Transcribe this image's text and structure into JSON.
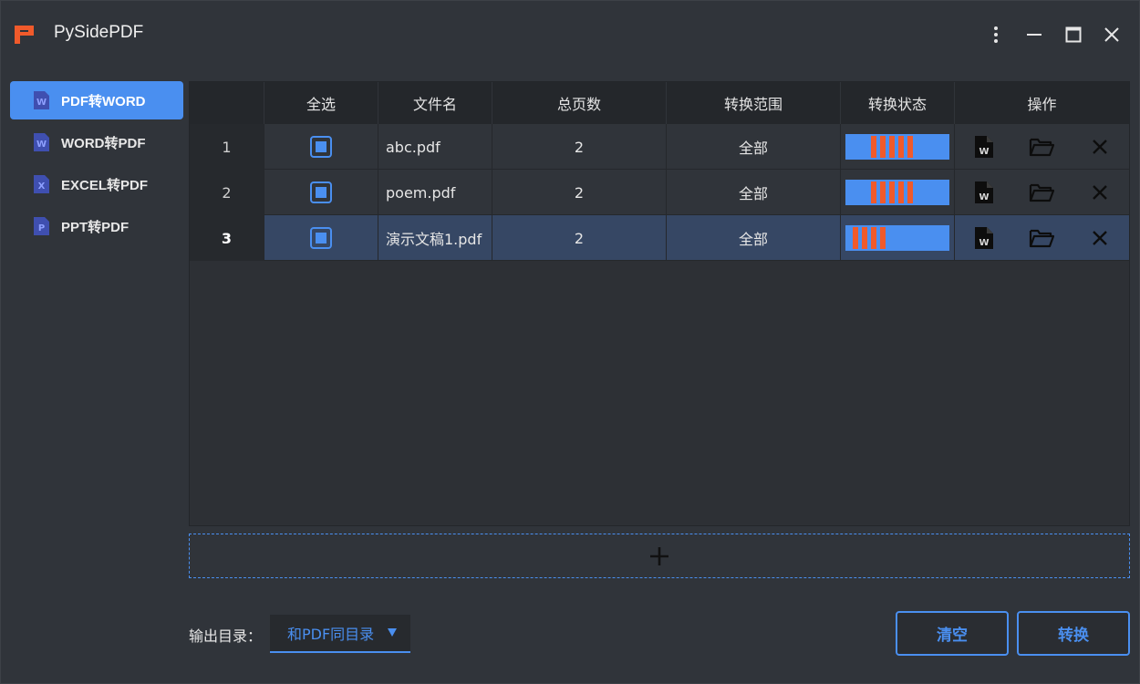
{
  "app": {
    "title": "PySidePDF"
  },
  "colors": {
    "accent": "#4a8ff0",
    "progress_fill": "#f05a2b",
    "background": "#30343a"
  },
  "sidebar": {
    "items": [
      {
        "label": "PDF转WORD",
        "icon": "word-doc-icon",
        "active": true
      },
      {
        "label": "WORD转PDF",
        "icon": "word-doc-icon",
        "active": false
      },
      {
        "label": "EXCEL转PDF",
        "icon": "excel-doc-icon",
        "active": false
      },
      {
        "label": "PPT转PDF",
        "icon": "ppt-doc-icon",
        "active": false
      }
    ]
  },
  "table": {
    "headers": [
      "",
      "全选",
      "文件名",
      "总页数",
      "转换范围",
      "转换状态",
      "操作"
    ],
    "rows": [
      {
        "num": "1",
        "checked": true,
        "filename": "abc.pdf",
        "pages": "2",
        "range": "全部",
        "progress": 0.65
      },
      {
        "num": "2",
        "checked": true,
        "filename": "poem.pdf",
        "pages": "2",
        "range": "全部",
        "progress": 0.65
      },
      {
        "num": "3",
        "checked": true,
        "filename": "演示文稿1.pdf",
        "pages": "2",
        "range": "全部",
        "progress": 0.45,
        "selected": true
      }
    ]
  },
  "output": {
    "label": "输出目录：",
    "selected": "和PDF同目录"
  },
  "buttons": {
    "clear": "清空",
    "convert": "转换"
  }
}
